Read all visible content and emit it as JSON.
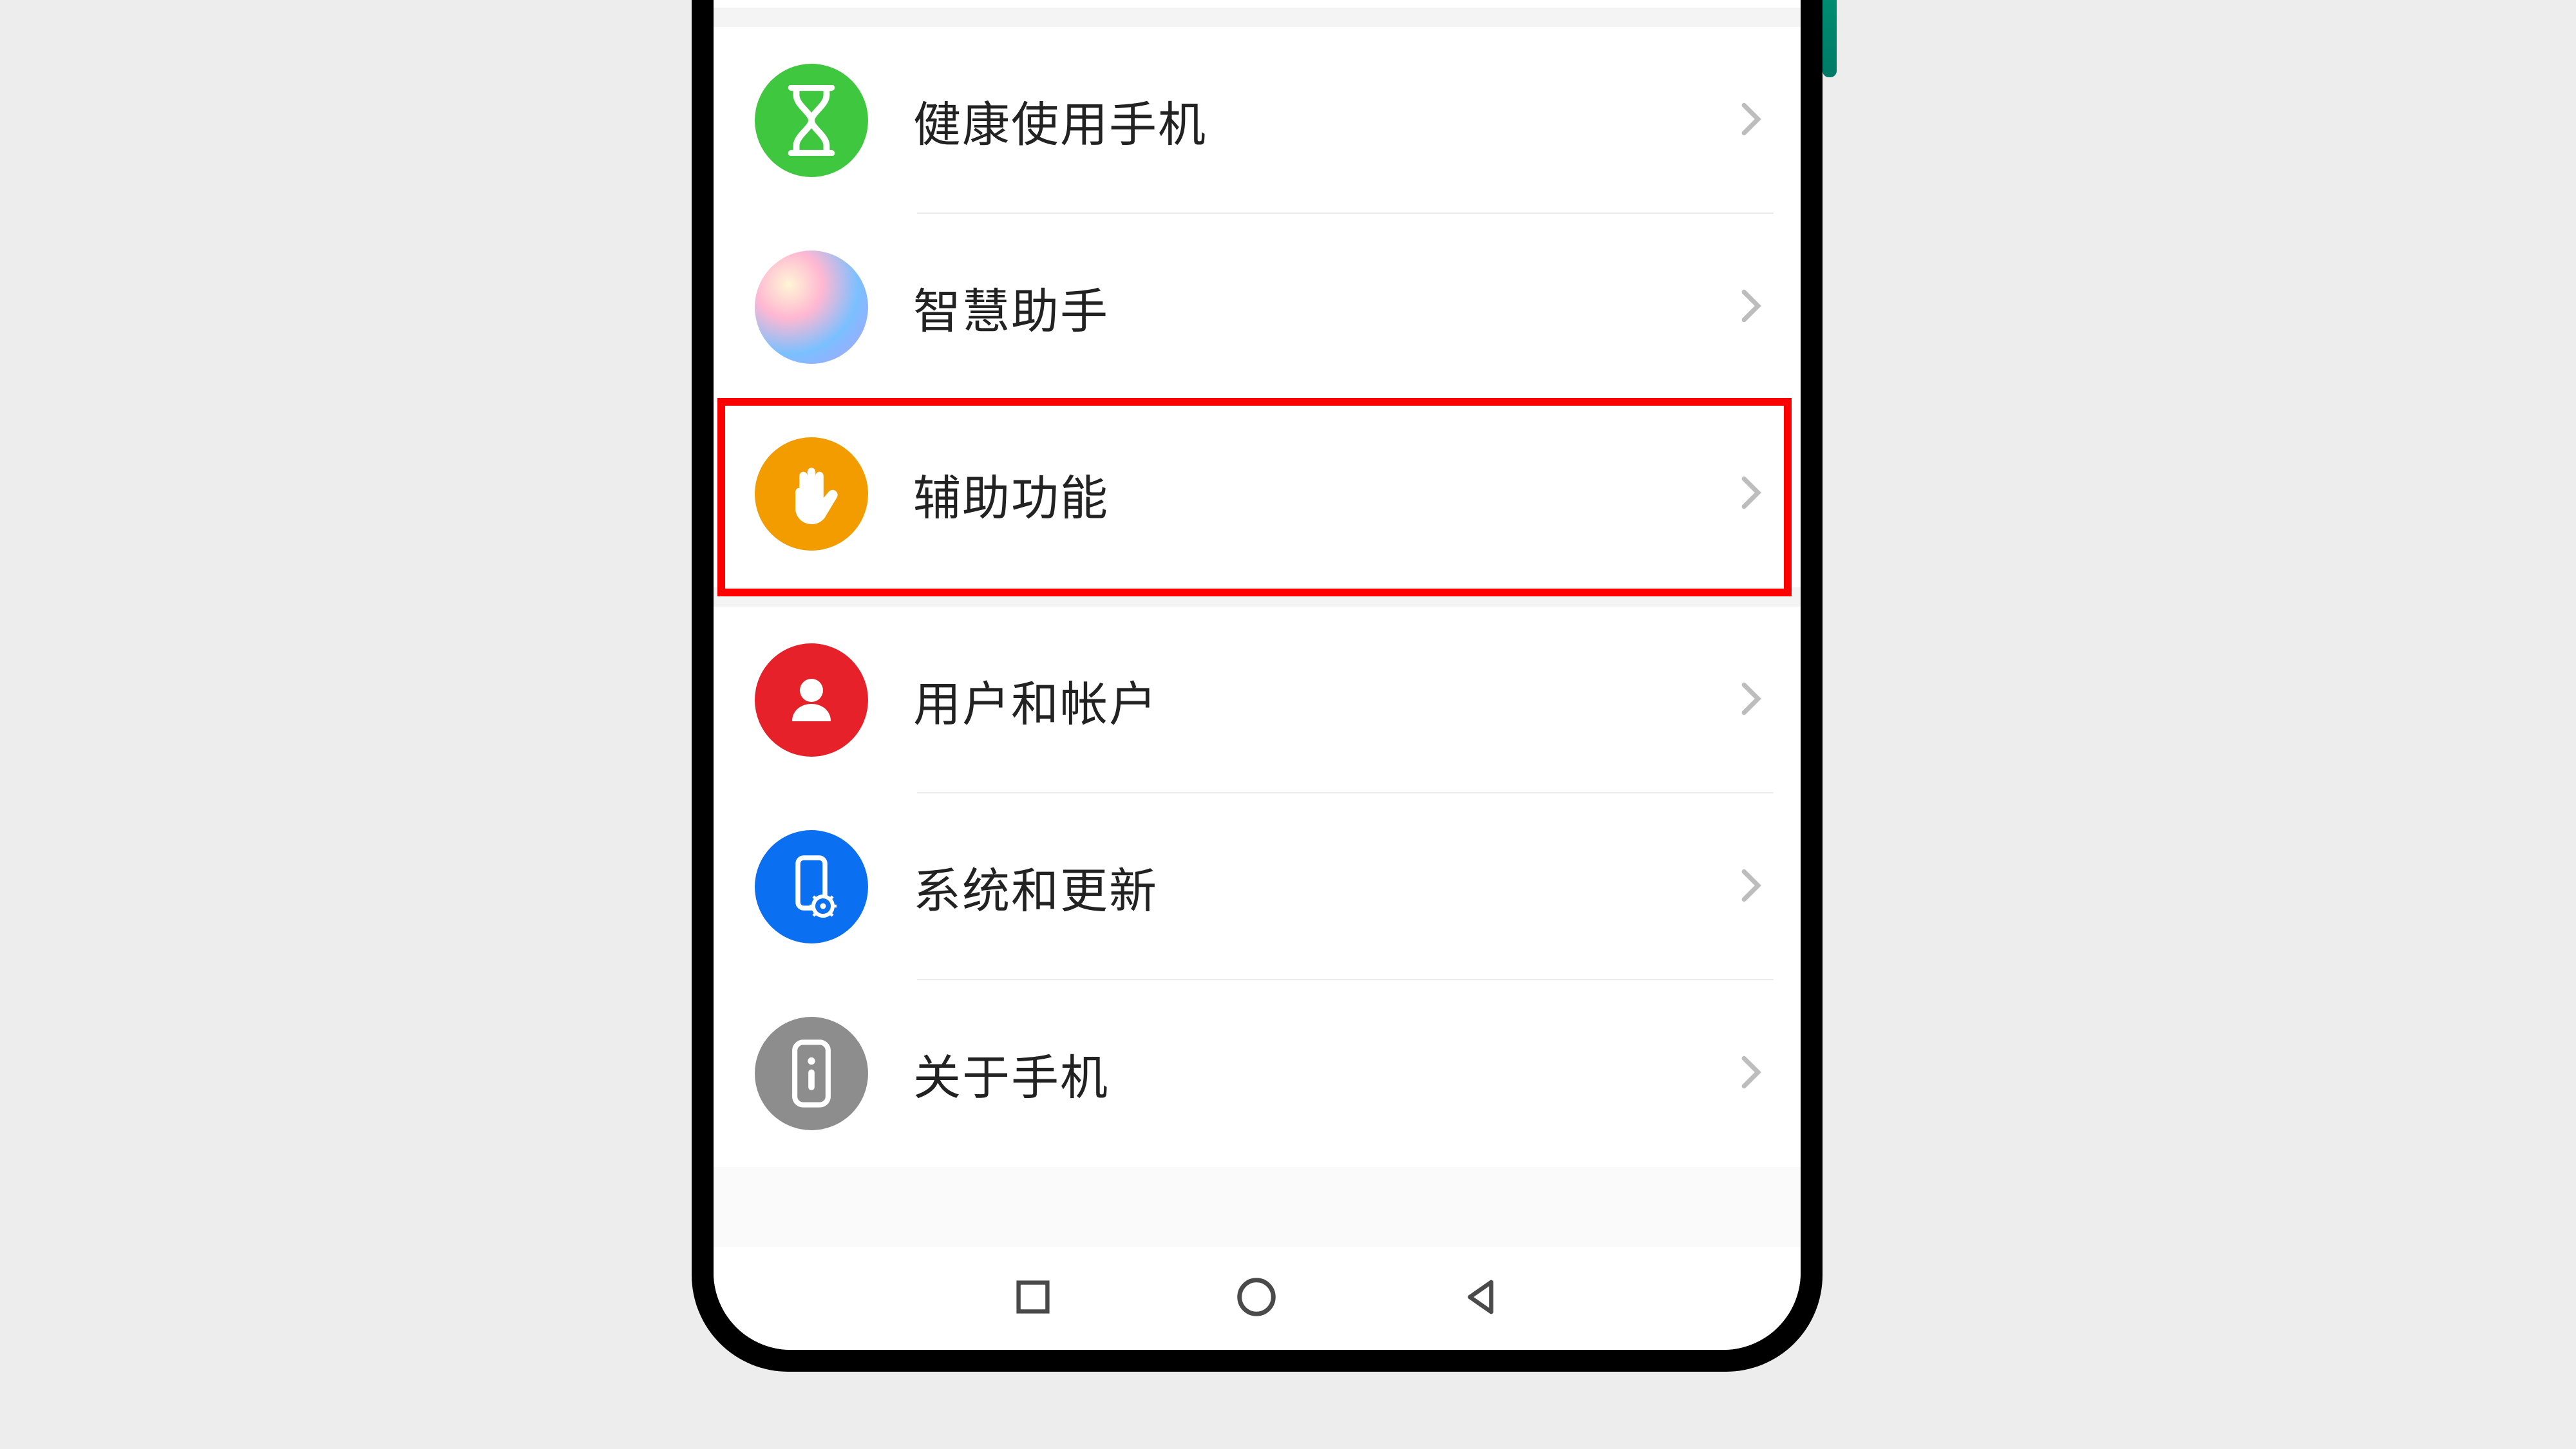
{
  "settings": {
    "items": [
      {
        "id": "digital-balance",
        "label": "健康使用手机",
        "icon": "hourglass",
        "icon_color": "#40c740"
      },
      {
        "id": "ai-assistant",
        "label": "智慧助手",
        "icon": "assistant",
        "icon_color": "#gradient"
      },
      {
        "id": "accessibility",
        "label": "辅助功能",
        "icon": "hand",
        "icon_color": "#f29c00"
      },
      {
        "id": "users-accounts",
        "label": "用户和帐户",
        "icon": "person",
        "icon_color": "#e62129"
      },
      {
        "id": "system-update",
        "label": "系统和更新",
        "icon": "phone-gear",
        "icon_color": "#0a6ff0"
      },
      {
        "id": "about-phone",
        "label": "关于手机",
        "icon": "info-phone",
        "icon_color": "#8d8d8d"
      }
    ]
  },
  "highlighted_item_id": "accessibility"
}
